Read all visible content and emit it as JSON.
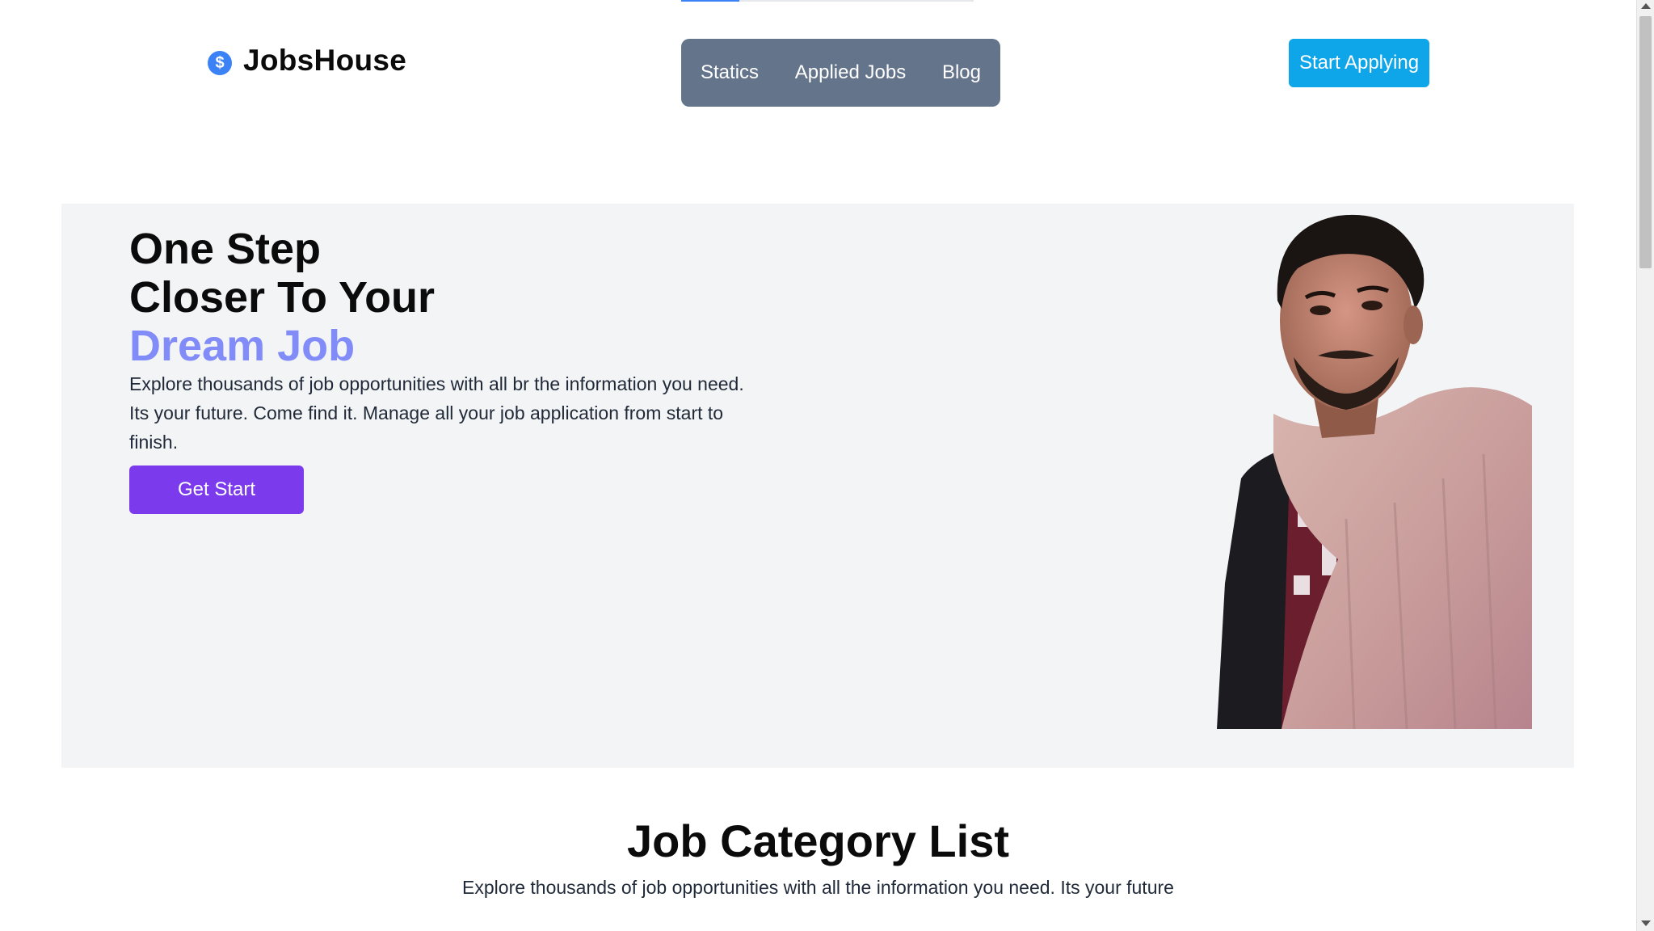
{
  "header": {
    "brand": "JobsHouse",
    "logo_symbol": "$",
    "nav": [
      "Statics",
      "Applied Jobs",
      "Blog"
    ],
    "cta": "Start Applying"
  },
  "hero": {
    "title_line1": "One Step",
    "title_line2": "Closer To Your",
    "title_accent": "Dream Job",
    "description": "Explore thousands of job opportunities with all br the information you need. Its your future. Come find it. Manage all your job application from start to finish.",
    "button": "Get Start",
    "image_icon": "person-portrait-photo"
  },
  "categories": {
    "title": "Job Category List",
    "subtitle": "Explore thousands of job opportunities with all the information you need. Its your future"
  },
  "colors": {
    "nav_bg": "#64748b",
    "cta_bg": "#0ea5e9",
    "accent_text": "#818cf8",
    "primary_button": "#7c3aed",
    "hero_bg": "#f3f4f6"
  }
}
